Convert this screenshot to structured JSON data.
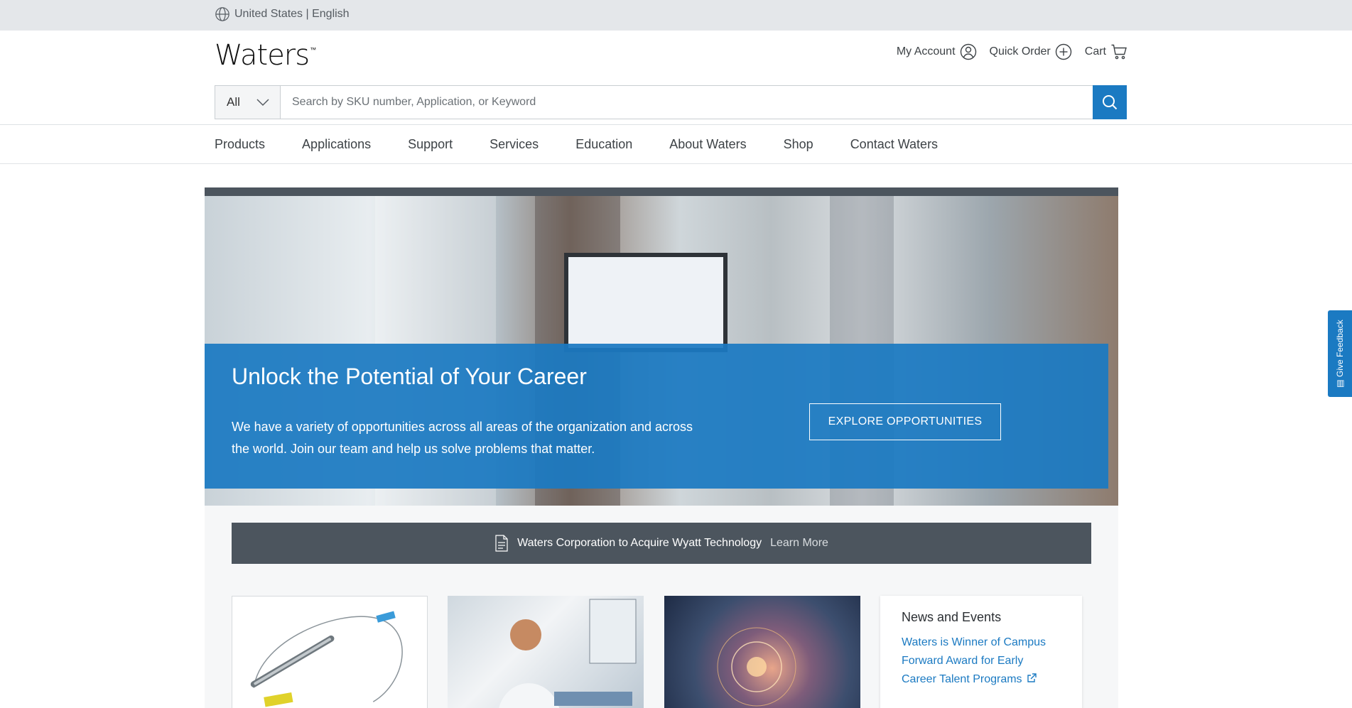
{
  "locale": {
    "label": "United States | English",
    "icon": "globe-icon"
  },
  "brand": {
    "name": "Waters",
    "trademark": "™"
  },
  "account_nav": [
    {
      "label": "My Account",
      "icon": "user-icon"
    },
    {
      "label": "Quick Order",
      "icon": "plus-circle-icon"
    },
    {
      "label": "Cart",
      "icon": "cart-icon"
    }
  ],
  "search": {
    "category": "All",
    "placeholder": "Search by SKU number, Application, or Keyword",
    "value": "",
    "icon": "search-icon"
  },
  "main_nav": [
    "Products",
    "Applications",
    "Support",
    "Services",
    "Education",
    "About Waters",
    "Shop",
    "Contact Waters"
  ],
  "hero": {
    "title": "Unlock the Potential of Your Career",
    "text": "We have a variety of opportunities across all areas of the organization and across the world. Join our team and help us solve problems that matter.",
    "button": "EXPLORE OPPORTUNITIES"
  },
  "news_banner": {
    "text": "Waters Corporation to Acquire Wyatt Technology",
    "link": "Learn More",
    "icon": "document-icon"
  },
  "news_events": {
    "heading": "News and Events",
    "link": "Waters is Winner of Campus Forward Award for Early Career Talent Programs",
    "icon": "external-link-icon"
  },
  "feedback": {
    "label": "Give Feedback",
    "icon": "feedback-icon"
  },
  "colors": {
    "brand_blue": "#1b7ac2",
    "dark_slate": "#4c555e",
    "top_bar": "#e4e7ea"
  }
}
